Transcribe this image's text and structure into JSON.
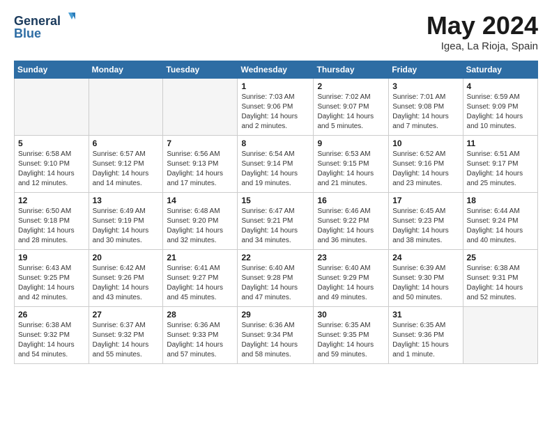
{
  "header": {
    "logo_line1": "General",
    "logo_line2": "Blue",
    "month": "May 2024",
    "location": "Igea, La Rioja, Spain"
  },
  "weekdays": [
    "Sunday",
    "Monday",
    "Tuesday",
    "Wednesday",
    "Thursday",
    "Friday",
    "Saturday"
  ],
  "weeks": [
    [
      {
        "day": "",
        "info": ""
      },
      {
        "day": "",
        "info": ""
      },
      {
        "day": "",
        "info": ""
      },
      {
        "day": "1",
        "info": "Sunrise: 7:03 AM\nSunset: 9:06 PM\nDaylight: 14 hours\nand 2 minutes."
      },
      {
        "day": "2",
        "info": "Sunrise: 7:02 AM\nSunset: 9:07 PM\nDaylight: 14 hours\nand 5 minutes."
      },
      {
        "day": "3",
        "info": "Sunrise: 7:01 AM\nSunset: 9:08 PM\nDaylight: 14 hours\nand 7 minutes."
      },
      {
        "day": "4",
        "info": "Sunrise: 6:59 AM\nSunset: 9:09 PM\nDaylight: 14 hours\nand 10 minutes."
      }
    ],
    [
      {
        "day": "5",
        "info": "Sunrise: 6:58 AM\nSunset: 9:10 PM\nDaylight: 14 hours\nand 12 minutes."
      },
      {
        "day": "6",
        "info": "Sunrise: 6:57 AM\nSunset: 9:12 PM\nDaylight: 14 hours\nand 14 minutes."
      },
      {
        "day": "7",
        "info": "Sunrise: 6:56 AM\nSunset: 9:13 PM\nDaylight: 14 hours\nand 17 minutes."
      },
      {
        "day": "8",
        "info": "Sunrise: 6:54 AM\nSunset: 9:14 PM\nDaylight: 14 hours\nand 19 minutes."
      },
      {
        "day": "9",
        "info": "Sunrise: 6:53 AM\nSunset: 9:15 PM\nDaylight: 14 hours\nand 21 minutes."
      },
      {
        "day": "10",
        "info": "Sunrise: 6:52 AM\nSunset: 9:16 PM\nDaylight: 14 hours\nand 23 minutes."
      },
      {
        "day": "11",
        "info": "Sunrise: 6:51 AM\nSunset: 9:17 PM\nDaylight: 14 hours\nand 25 minutes."
      }
    ],
    [
      {
        "day": "12",
        "info": "Sunrise: 6:50 AM\nSunset: 9:18 PM\nDaylight: 14 hours\nand 28 minutes."
      },
      {
        "day": "13",
        "info": "Sunrise: 6:49 AM\nSunset: 9:19 PM\nDaylight: 14 hours\nand 30 minutes."
      },
      {
        "day": "14",
        "info": "Sunrise: 6:48 AM\nSunset: 9:20 PM\nDaylight: 14 hours\nand 32 minutes."
      },
      {
        "day": "15",
        "info": "Sunrise: 6:47 AM\nSunset: 9:21 PM\nDaylight: 14 hours\nand 34 minutes."
      },
      {
        "day": "16",
        "info": "Sunrise: 6:46 AM\nSunset: 9:22 PM\nDaylight: 14 hours\nand 36 minutes."
      },
      {
        "day": "17",
        "info": "Sunrise: 6:45 AM\nSunset: 9:23 PM\nDaylight: 14 hours\nand 38 minutes."
      },
      {
        "day": "18",
        "info": "Sunrise: 6:44 AM\nSunset: 9:24 PM\nDaylight: 14 hours\nand 40 minutes."
      }
    ],
    [
      {
        "day": "19",
        "info": "Sunrise: 6:43 AM\nSunset: 9:25 PM\nDaylight: 14 hours\nand 42 minutes."
      },
      {
        "day": "20",
        "info": "Sunrise: 6:42 AM\nSunset: 9:26 PM\nDaylight: 14 hours\nand 43 minutes."
      },
      {
        "day": "21",
        "info": "Sunrise: 6:41 AM\nSunset: 9:27 PM\nDaylight: 14 hours\nand 45 minutes."
      },
      {
        "day": "22",
        "info": "Sunrise: 6:40 AM\nSunset: 9:28 PM\nDaylight: 14 hours\nand 47 minutes."
      },
      {
        "day": "23",
        "info": "Sunrise: 6:40 AM\nSunset: 9:29 PM\nDaylight: 14 hours\nand 49 minutes."
      },
      {
        "day": "24",
        "info": "Sunrise: 6:39 AM\nSunset: 9:30 PM\nDaylight: 14 hours\nand 50 minutes."
      },
      {
        "day": "25",
        "info": "Sunrise: 6:38 AM\nSunset: 9:31 PM\nDaylight: 14 hours\nand 52 minutes."
      }
    ],
    [
      {
        "day": "26",
        "info": "Sunrise: 6:38 AM\nSunset: 9:32 PM\nDaylight: 14 hours\nand 54 minutes."
      },
      {
        "day": "27",
        "info": "Sunrise: 6:37 AM\nSunset: 9:32 PM\nDaylight: 14 hours\nand 55 minutes."
      },
      {
        "day": "28",
        "info": "Sunrise: 6:36 AM\nSunset: 9:33 PM\nDaylight: 14 hours\nand 57 minutes."
      },
      {
        "day": "29",
        "info": "Sunrise: 6:36 AM\nSunset: 9:34 PM\nDaylight: 14 hours\nand 58 minutes."
      },
      {
        "day": "30",
        "info": "Sunrise: 6:35 AM\nSunset: 9:35 PM\nDaylight: 14 hours\nand 59 minutes."
      },
      {
        "day": "31",
        "info": "Sunrise: 6:35 AM\nSunset: 9:36 PM\nDaylight: 15 hours\nand 1 minute."
      },
      {
        "day": "",
        "info": ""
      }
    ]
  ]
}
